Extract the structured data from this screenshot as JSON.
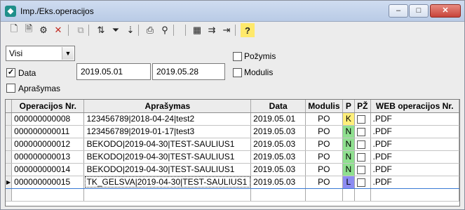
{
  "window": {
    "title": "Imp./Eks.operacijos",
    "minimize": "–",
    "maximize": "□",
    "close": "✕"
  },
  "toolbar": {
    "buttons": [
      {
        "name": "new-document-icon",
        "glyph": "🗋"
      },
      {
        "name": "edit-document-icon",
        "glyph": "🗎"
      },
      {
        "name": "properties-icon",
        "glyph": "⚙"
      },
      {
        "name": "delete-icon",
        "glyph": "✕"
      },
      {
        "name": "copy-icon",
        "glyph": "⧉"
      },
      {
        "name": "sort-icon",
        "glyph": "⇅"
      },
      {
        "name": "filter-icon",
        "glyph": "⏷"
      },
      {
        "name": "sort-az-icon",
        "glyph": "⇣"
      },
      {
        "name": "print-icon",
        "glyph": "⎙"
      },
      {
        "name": "find-icon",
        "glyph": "⚲"
      },
      {
        "name": "add-grid-icon",
        "glyph": "▦"
      },
      {
        "name": "move-grid-icon",
        "glyph": "⇉"
      },
      {
        "name": "insert-column-icon",
        "glyph": "⇥"
      },
      {
        "name": "help-icon",
        "glyph": "?"
      }
    ]
  },
  "filters": {
    "type_select": "Visi",
    "data_label": "Data",
    "data_checked": true,
    "date_from": "2019.05.01",
    "date_to": "2019.05.28",
    "aprasymas_label": "Aprašymas",
    "aprasymas_checked": false,
    "pozymis_label": "Požymis",
    "pozymis_checked": false,
    "modulis_label": "Modulis",
    "modulis_checked": false
  },
  "grid": {
    "columns": [
      "Operacijos Nr.",
      "Aprašymas",
      "Data",
      "Modulis",
      "P",
      "PŽ",
      "WEB operacijos Nr."
    ],
    "rows": [
      {
        "nr": "000000000008",
        "desc": "123456789|2018-04-24|test2",
        "date": "2019.05.01",
        "mod": "PO",
        "p": "K",
        "p_color": "#ffef7a",
        "web": ".PDF"
      },
      {
        "nr": "000000000011",
        "desc": "123456789|2019-01-17|test3",
        "date": "2019.05.03",
        "mod": "PO",
        "p": "N",
        "p_color": "#8fe08f",
        "web": ".PDF"
      },
      {
        "nr": "000000000012",
        "desc": "BEKODO|2019-04-30|TEST-SAULIUS1",
        "date": "2019.05.03",
        "mod": "PO",
        "p": "N",
        "p_color": "#8fe08f",
        "web": ".PDF"
      },
      {
        "nr": "000000000013",
        "desc": "BEKODO|2019-04-30|TEST-SAULIUS1",
        "date": "2019.05.03",
        "mod": "PO",
        "p": "N",
        "p_color": "#8fe08f",
        "web": ".PDF"
      },
      {
        "nr": "000000000014",
        "desc": "BEKODO|2019-04-30|TEST-SAULIUS1",
        "date": "2019.05.03",
        "mod": "PO",
        "p": "N",
        "p_color": "#8fe08f",
        "web": ".PDF"
      },
      {
        "nr": "000000000015",
        "desc": "TK_GELSVA|2019-04-30|TEST-SAULIUS1",
        "date": "2019.05.03",
        "mod": "PO",
        "p": "L",
        "p_color": "#8c8cf2",
        "web": ".PDF"
      }
    ],
    "selected_row": 5
  }
}
